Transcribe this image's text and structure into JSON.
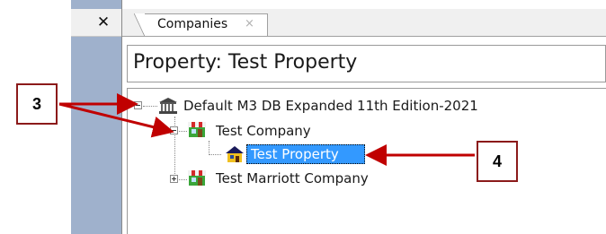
{
  "window": {
    "close_glyph": "✕",
    "tab": {
      "label": "Companies",
      "close_glyph": "×"
    },
    "title": "Property: Test Property"
  },
  "tree": {
    "root": {
      "label": "Default M3 DB Expanded 11th Edition-2021",
      "icon": "bank-building-icon",
      "expanded": true
    },
    "company1": {
      "label": "Test Company",
      "icon": "storefront-icon",
      "expanded": true
    },
    "property1": {
      "label": "Test Property",
      "icon": "house-icon",
      "selected": true
    },
    "company2": {
      "label": "Test Marriott Company",
      "icon": "storefront-icon",
      "expanded": false
    }
  },
  "callouts": {
    "left": "3",
    "right": "4",
    "color": "#8b1a1a"
  },
  "colors": {
    "selection": "#3399ff",
    "dock": "#9fb1cc",
    "arrow": "#c00000"
  }
}
